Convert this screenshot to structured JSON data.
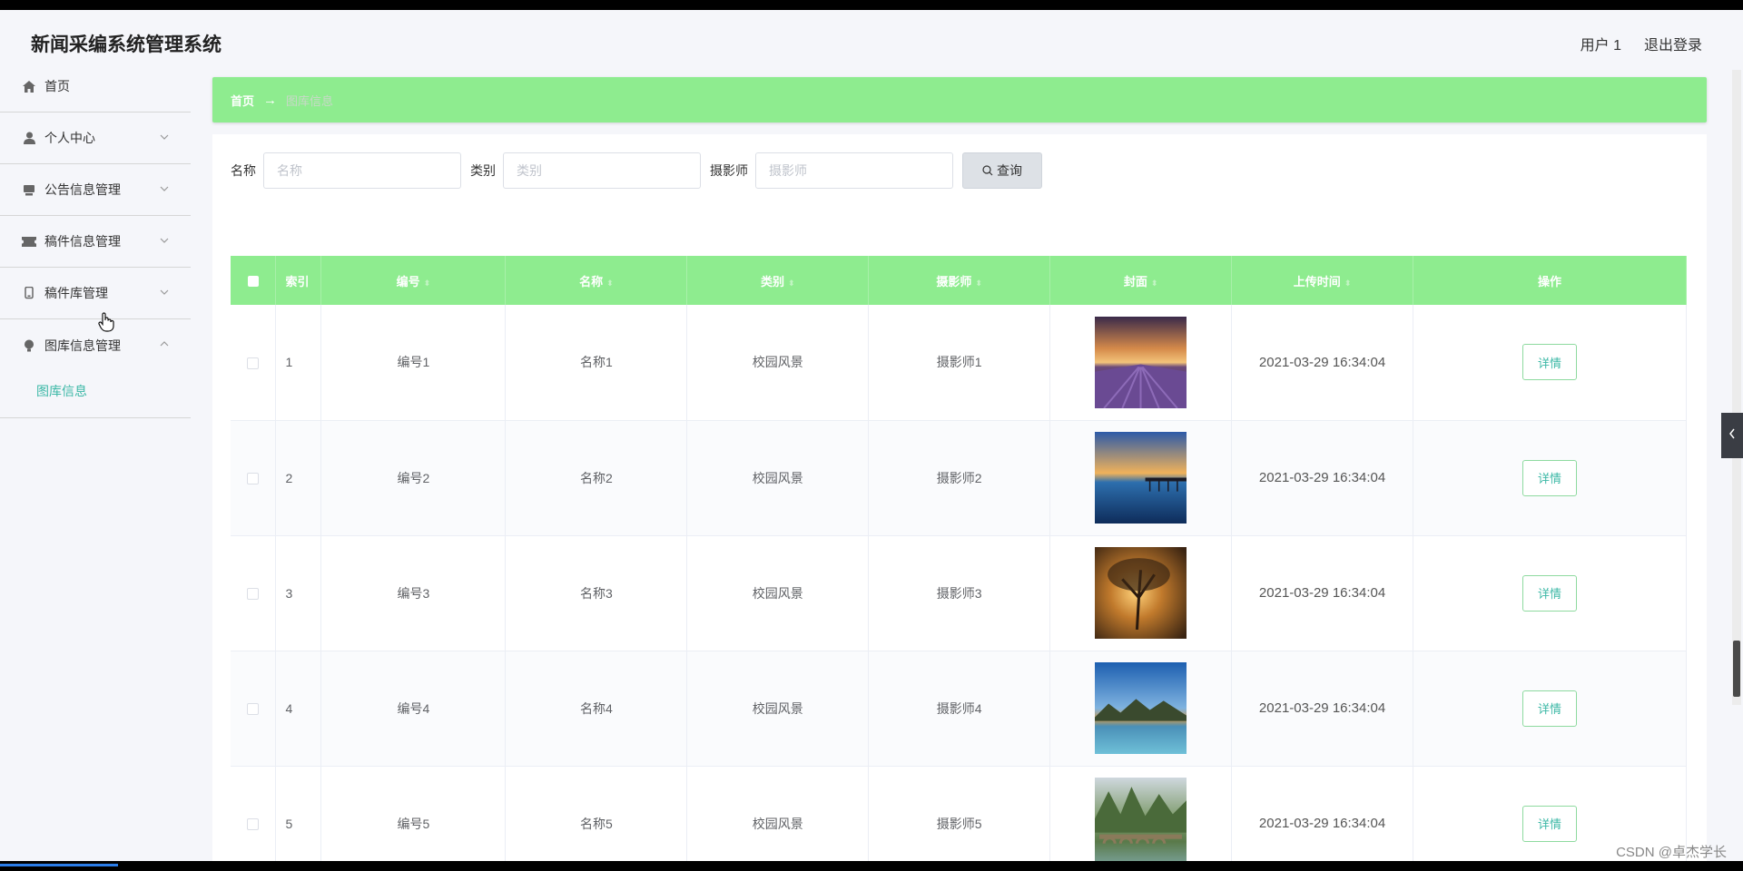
{
  "header": {
    "title": "新闻采编系统管理系统",
    "user": "用户 1",
    "logout": "退出登录"
  },
  "sidebar": {
    "items": [
      {
        "label": "首页",
        "icon": "home-icon"
      },
      {
        "label": "个人中心",
        "icon": "user-icon"
      },
      {
        "label": "公告信息管理",
        "icon": "notice-icon"
      },
      {
        "label": "稿件信息管理",
        "icon": "ticket-icon"
      },
      {
        "label": "稿件库管理",
        "icon": "device-icon"
      },
      {
        "label": "图库信息管理",
        "icon": "bulb-icon"
      }
    ],
    "submenu": {
      "label": "图库信息"
    }
  },
  "breadcrumb": {
    "home": "首页",
    "arrow": "→",
    "current": "图库信息"
  },
  "search": {
    "name_label": "名称",
    "name_placeholder": "名称",
    "category_label": "类别",
    "category_placeholder": "类别",
    "photographer_label": "摄影师",
    "photographer_placeholder": "摄影师",
    "button": "查询"
  },
  "table": {
    "columns": [
      "索引",
      "编号",
      "名称",
      "类别",
      "摄影师",
      "封面",
      "上传时间",
      "操作"
    ],
    "rows": [
      {
        "index": "1",
        "code": "编号1",
        "name": "名称1",
        "category": "校园风景",
        "photographer": "摄影师1",
        "time": "2021-03-29 16:34:04",
        "action": "详情"
      },
      {
        "index": "2",
        "code": "编号2",
        "name": "名称2",
        "category": "校园风景",
        "photographer": "摄影师2",
        "time": "2021-03-29 16:34:04",
        "action": "详情"
      },
      {
        "index": "3",
        "code": "编号3",
        "name": "名称3",
        "category": "校园风景",
        "photographer": "摄影师3",
        "time": "2021-03-29 16:34:04",
        "action": "详情"
      },
      {
        "index": "4",
        "code": "编号4",
        "name": "名称4",
        "category": "校园风景",
        "photographer": "摄影师4",
        "time": "2021-03-29 16:34:04",
        "action": "详情"
      },
      {
        "index": "5",
        "code": "编号5",
        "name": "名称5",
        "category": "校园风景",
        "photographer": "摄影师5",
        "time": "2021-03-29 16:34:04",
        "action": "详情"
      }
    ]
  },
  "watermark": "CSDN @卓杰学长",
  "colors": {
    "accent": "#8eec8f",
    "link": "#3cb8a6",
    "sidebar_bg": "#f5f6fa"
  }
}
